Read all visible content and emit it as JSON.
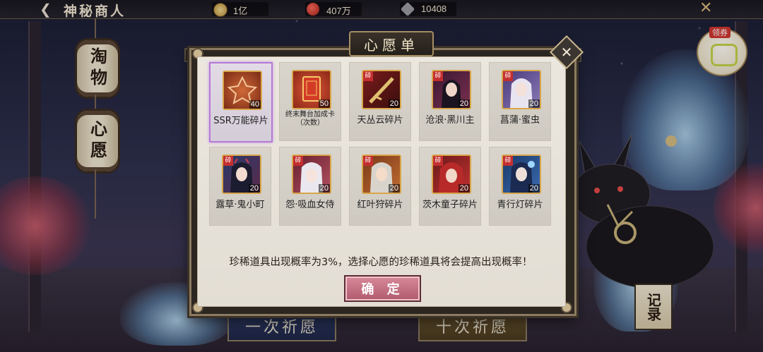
{
  "topbar": {
    "title": "神秘商人",
    "resources": [
      {
        "icon": "gold-coin-icon",
        "value": "1亿"
      },
      {
        "icon": "magatama-icon",
        "value": "407万"
      },
      {
        "icon": "token-icon",
        "value": "10408"
      }
    ]
  },
  "side_tabs": [
    {
      "label": "淘物"
    },
    {
      "label": "心愿"
    }
  ],
  "coupon": {
    "badge": "领券"
  },
  "bottom": {
    "single_pray": "一次祈愿",
    "ten_pray": "十次祈愿",
    "record": "记录"
  },
  "modal": {
    "title": "心愿单",
    "items": [
      {
        "name": "SSR万能碎片",
        "qty": "40",
        "fragment": false,
        "selected": true,
        "icon": "ssr-shard-icon"
      },
      {
        "name": "终末舞台加成卡（次数）",
        "qty": "50",
        "fragment": false,
        "selected": false,
        "icon": "bonus-card-icon"
      },
      {
        "name": "天丛云碎片",
        "qty": "20",
        "fragment": true,
        "selected": false,
        "icon": "ame-no-murakumo-icon"
      },
      {
        "name": "沧浪·黑川主",
        "qty": "20",
        "fragment": true,
        "selected": false,
        "icon": "kurokawa-icon"
      },
      {
        "name": "菖蒲·蜜虫",
        "qty": "20",
        "fragment": true,
        "selected": false,
        "icon": "mitsumushi-icon"
      },
      {
        "name": "露草·鬼小町",
        "qty": "20",
        "fragment": true,
        "selected": false,
        "icon": "onikomachi-icon"
      },
      {
        "name": "怨·吸血女侍",
        "qty": "20",
        "fragment": true,
        "selected": false,
        "icon": "vampire-maid-icon"
      },
      {
        "name": "红叶狩碎片",
        "qty": "20",
        "fragment": true,
        "selected": false,
        "icon": "momiji-icon"
      },
      {
        "name": "茨木童子碎片",
        "qty": "20",
        "fragment": true,
        "selected": false,
        "icon": "ibaraki-icon"
      },
      {
        "name": "青行灯碎片",
        "qty": "20",
        "fragment": true,
        "selected": false,
        "icon": "aoandon-icon"
      }
    ],
    "fragment_label": "碎",
    "notice": "珍稀道具出现概率为3%，选择心愿的珍稀道具将会提高出现概率！",
    "confirm": "确 定"
  },
  "colors": {
    "accent_confirm": "#b05a6d",
    "selected_border": "#b57ad6",
    "fragment_badge": "#c42e2e",
    "icon_border": "#d8a64a"
  }
}
